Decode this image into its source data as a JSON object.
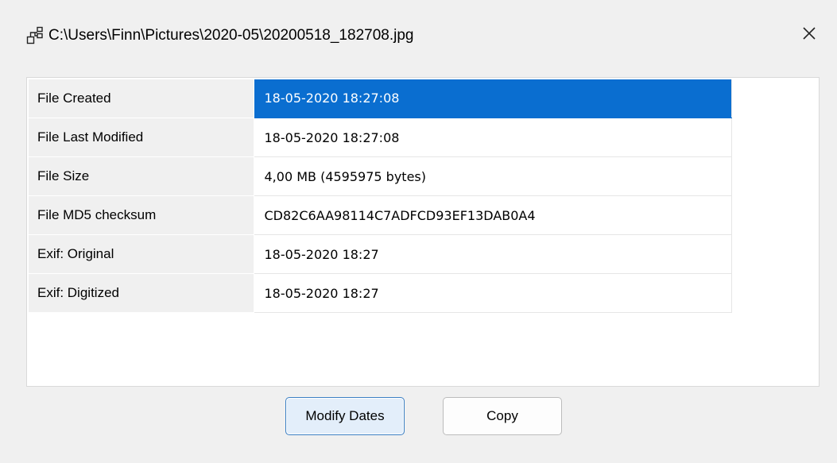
{
  "window": {
    "title": "C:\\Users\\Finn\\Pictures\\2020-05\\20200518_182708.jpg",
    "app_icon": "hierarchy-icon",
    "close_icon": "close-icon"
  },
  "properties": {
    "selected_index": 0,
    "selection_color": "#0a6ed0",
    "rows": [
      {
        "key": "File Created",
        "value": "18-05-2020 18:27:08"
      },
      {
        "key": "File Last Modified",
        "value": "18-05-2020 18:27:08"
      },
      {
        "key": "File Size",
        "value": "4,00 MB (4595975 bytes)"
      },
      {
        "key": "File MD5 checksum",
        "value": "CD82C6AA98114C7ADFCD93EF13DAB0A4"
      },
      {
        "key": "Exif: Original",
        "value": "18-05-2020 18:27"
      },
      {
        "key": "Exif: Digitized",
        "value": "18-05-2020 18:27"
      }
    ]
  },
  "buttons": {
    "modify_label": "Modify Dates",
    "copy_label": "Copy"
  }
}
